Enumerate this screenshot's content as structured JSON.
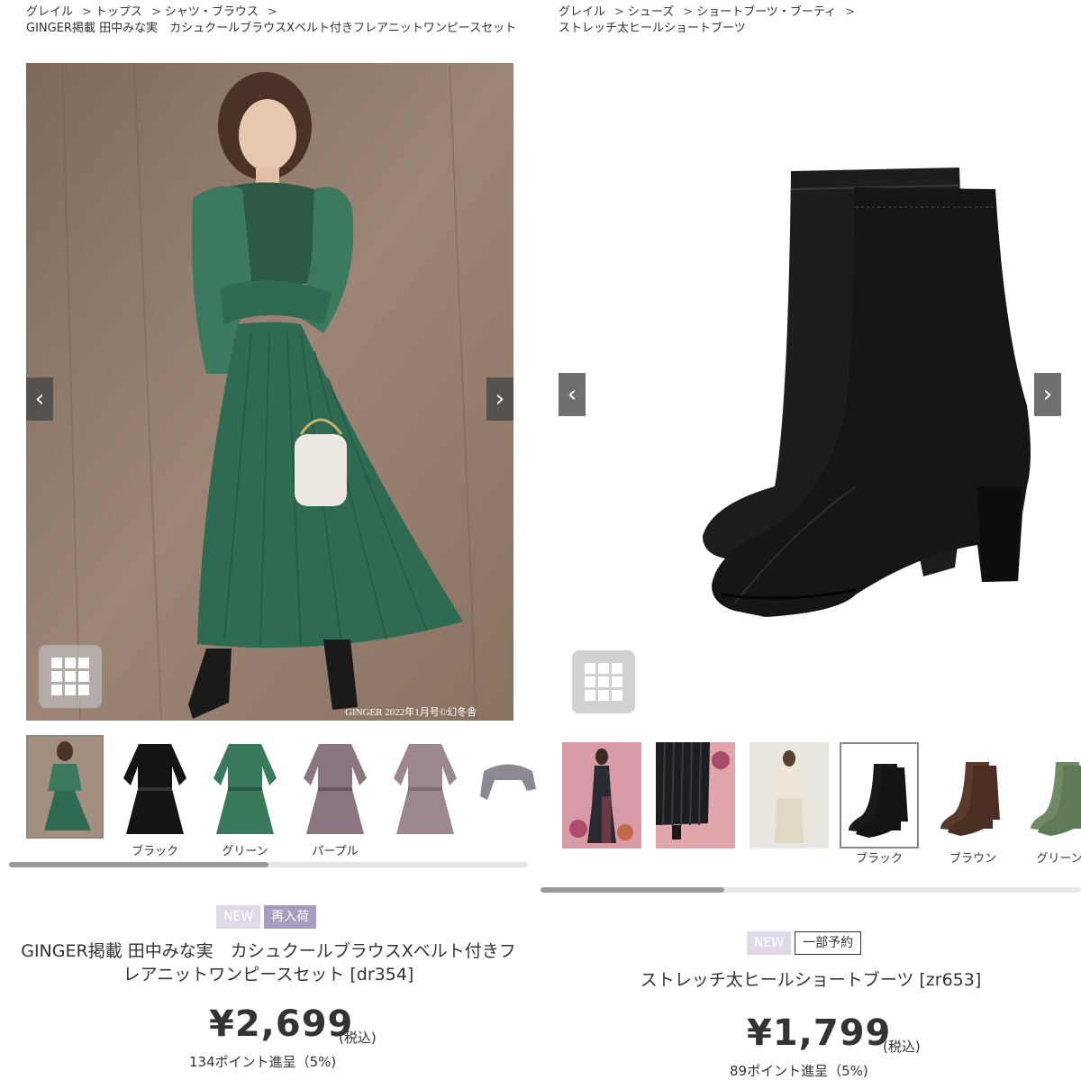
{
  "left": {
    "breadcrumb": [
      "グレイル",
      "トップス",
      "シャツ・ブラウス"
    ],
    "breadcrumb_current": "GINGER掲載 田中みな実　カシュクールブラウスXベルト付きフレアニットワンピースセット",
    "image_credit": "GINGER 2022年1月号©幻冬舎",
    "prev_icon": "chevron-left-icon",
    "next_icon": "chevron-right-icon",
    "thumbnails": [
      {
        "caption": ""
      },
      {
        "caption": "ブラック"
      },
      {
        "caption": "グリーン"
      },
      {
        "caption": "パープル"
      },
      {
        "caption": ""
      },
      {
        "caption": ""
      }
    ],
    "scroll_progress": 0.5,
    "badges": [
      "NEW",
      "再入荷"
    ],
    "title": "GINGER掲載 田中みな実　カシュクールブラウスXベルト付きフレアニットワンピースセット [dr354]",
    "price": "¥2,699",
    "tax_label": "(税込)",
    "points": "134ポイント進呈（5%)"
  },
  "right": {
    "breadcrumb": [
      "グレイル",
      "シューズ",
      "ショートブーツ・ブーティ"
    ],
    "breadcrumb_current": "ストレッチ太ヒールショートブーツ",
    "prev_icon": "chevron-left-icon",
    "next_icon": "chevron-right-icon",
    "thumbnails": [
      {
        "caption": ""
      },
      {
        "caption": ""
      },
      {
        "caption": ""
      },
      {
        "caption": "ブラック"
      },
      {
        "caption": "ブラウン"
      },
      {
        "caption": "グリーン"
      }
    ],
    "scroll_progress": 0.34,
    "badges": [
      "NEW",
      "一部予約"
    ],
    "title": "ストレッチ太ヒールショートブーツ [zr653]",
    "price": "¥1,799",
    "tax_label": "(税込)",
    "points": "89ポイント進呈（5%)"
  },
  "colors": {
    "badge_new": "#e2d9e8",
    "badge_restock": "#a89cc2",
    "arrow_bg": "#464646",
    "scroll_thumb": "#9a9a9a"
  }
}
